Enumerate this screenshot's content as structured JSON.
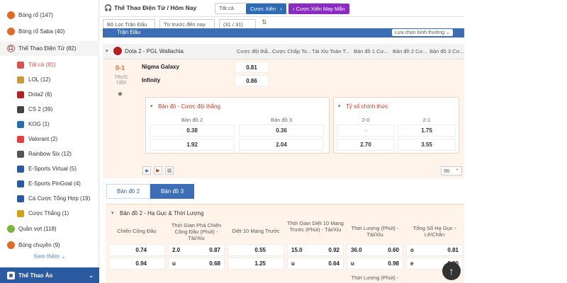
{
  "sidebar": {
    "items": [
      {
        "label": "Bóng rổ (147)",
        "icon": "basketball-icon",
        "color": "#e06a2a"
      },
      {
        "label": "Bóng rổ Saba (40)",
        "icon": "basketball-saba-icon",
        "color": "#e06a2a"
      },
      {
        "label": "Thể Thao Điện Tử (82)",
        "icon": "esports-headset-icon",
        "color": "#d9534f"
      }
    ],
    "sub_items": [
      {
        "label": "Tất cả (81)",
        "icon": "grid-icon",
        "color": "#d9534f"
      },
      {
        "label": "LOL (12)",
        "icon": "lol-icon",
        "color": "#c89b3c"
      },
      {
        "label": "Dota2 (6)",
        "icon": "dota2-icon",
        "color": "#b22222"
      },
      {
        "label": "CS 2 (39)",
        "icon": "cs2-icon",
        "color": "#444444"
      },
      {
        "label": "KOG (1)",
        "icon": "kog-icon",
        "color": "#2b6cb0"
      },
      {
        "label": "Valorant (2)",
        "icon": "valorant-icon",
        "color": "#e53e3e"
      },
      {
        "label": "Rainbow Six (12)",
        "icon": "rainbow-six-icon",
        "color": "#555555"
      },
      {
        "label": "E-Sports Virtual (5)",
        "icon": "esports-virtual-icon",
        "color": "#2c5aa0"
      },
      {
        "label": "E-Sports PinGoal (4)",
        "icon": "pingoal-icon",
        "color": "#2c5aa0"
      },
      {
        "label": "Cá Cược Tổng Hợp (19)",
        "icon": "combo-bet-icon",
        "color": "#2c5aa0"
      },
      {
        "label": "Cược Thắng (1)",
        "icon": "trophy-icon",
        "color": "#d4a017"
      }
    ],
    "bottom_items": [
      {
        "label": "Quần vợt (118)",
        "icon": "tennis-icon",
        "color": "#7cb342"
      },
      {
        "label": "Bóng chuyền (9)",
        "icon": "volleyball-icon",
        "color": "#e06a2a"
      }
    ],
    "more_label": "Xem thêm",
    "virtual_label": "Thể Thao Ảo"
  },
  "topbar": {
    "title": "Thể Thao Điện Tử / Hôm Nay",
    "select_value": "Tất cả",
    "parlay_label": "Cược Xiên",
    "lucky_parlay_label": "Cược Xiên May Mắn"
  },
  "filterbar": {
    "league_filter": "Bộ Lọc Trận Đấu",
    "time_filter": "Từ trước đến nay",
    "count": "(31 / 31) Giải"
  },
  "league": {
    "tab_label": "Trận Đấu",
    "sort_label": "Lựa chọn bình thường",
    "name": "Dota 2 - PGL Wallachia",
    "col_headers": [
      "Cược đội thắ...",
      "Cược Chấp To...",
      "Tài Xỉu Toàn T...",
      "Bản đồ 1 Cư...",
      "Bản đồ 2 Cư...",
      "Bản đồ 3 Cư..."
    ]
  },
  "match": {
    "score": "0-1",
    "status": "TRỰC TIẾP",
    "team1": "Nigma Galaxy",
    "team2": "Infinity",
    "odds1": "0.81",
    "odds2": "0.86",
    "more_count": "96"
  },
  "winner_card": {
    "title": "Bản đồ - Cược đội thắng",
    "col1": "Bản đồ 2",
    "col2": "Bản đồ 3",
    "rows": [
      [
        "0.38",
        "0.36"
      ],
      [
        "1.92",
        "2.04"
      ]
    ]
  },
  "score_card": {
    "title": "Tỷ số chính thức",
    "col1": "2-0",
    "col2": "2-1",
    "rows": [
      [
        "–",
        "1.75"
      ],
      [
        "2.70",
        "3.55"
      ]
    ]
  },
  "map_tabs": [
    "Bản đồ 2",
    "Bản đồ 3"
  ],
  "map2": {
    "section_title": "Bản đồ 2 - Hạ Gục & Thời Lượng",
    "headers": [
      "Chiến Công Đầu",
      "Thời Gian Phá Chiến Công Đầu (Phút) - Tài/Xỉu",
      "Diệt 10 Mạng Trước",
      "Thời Gian Diệt 10 Mạng Trước (Phút) - Tài/Xỉu",
      "Thời Lượng (Phút) - Tài/Xỉu",
      "Tổng Số Hạ Gục - Lẻ/Chẵn"
    ],
    "row1": [
      [
        "",
        "0.74"
      ],
      [
        "2.0",
        "0.87"
      ],
      [
        "",
        "0.55"
      ],
      [
        "15.0",
        "0.92"
      ],
      [
        "36.0",
        "0.60"
      ],
      [
        "o",
        "0.81"
      ]
    ],
    "row2": [
      [
        "",
        "0.94"
      ],
      [
        "u",
        "0.68"
      ],
      [
        "",
        "1.25"
      ],
      [
        "u",
        "0.64"
      ],
      [
        "u",
        "0.98"
      ],
      [
        "e",
        "0.80"
      ]
    ],
    "next_header": "Thời Lượng (Phút) -"
  }
}
